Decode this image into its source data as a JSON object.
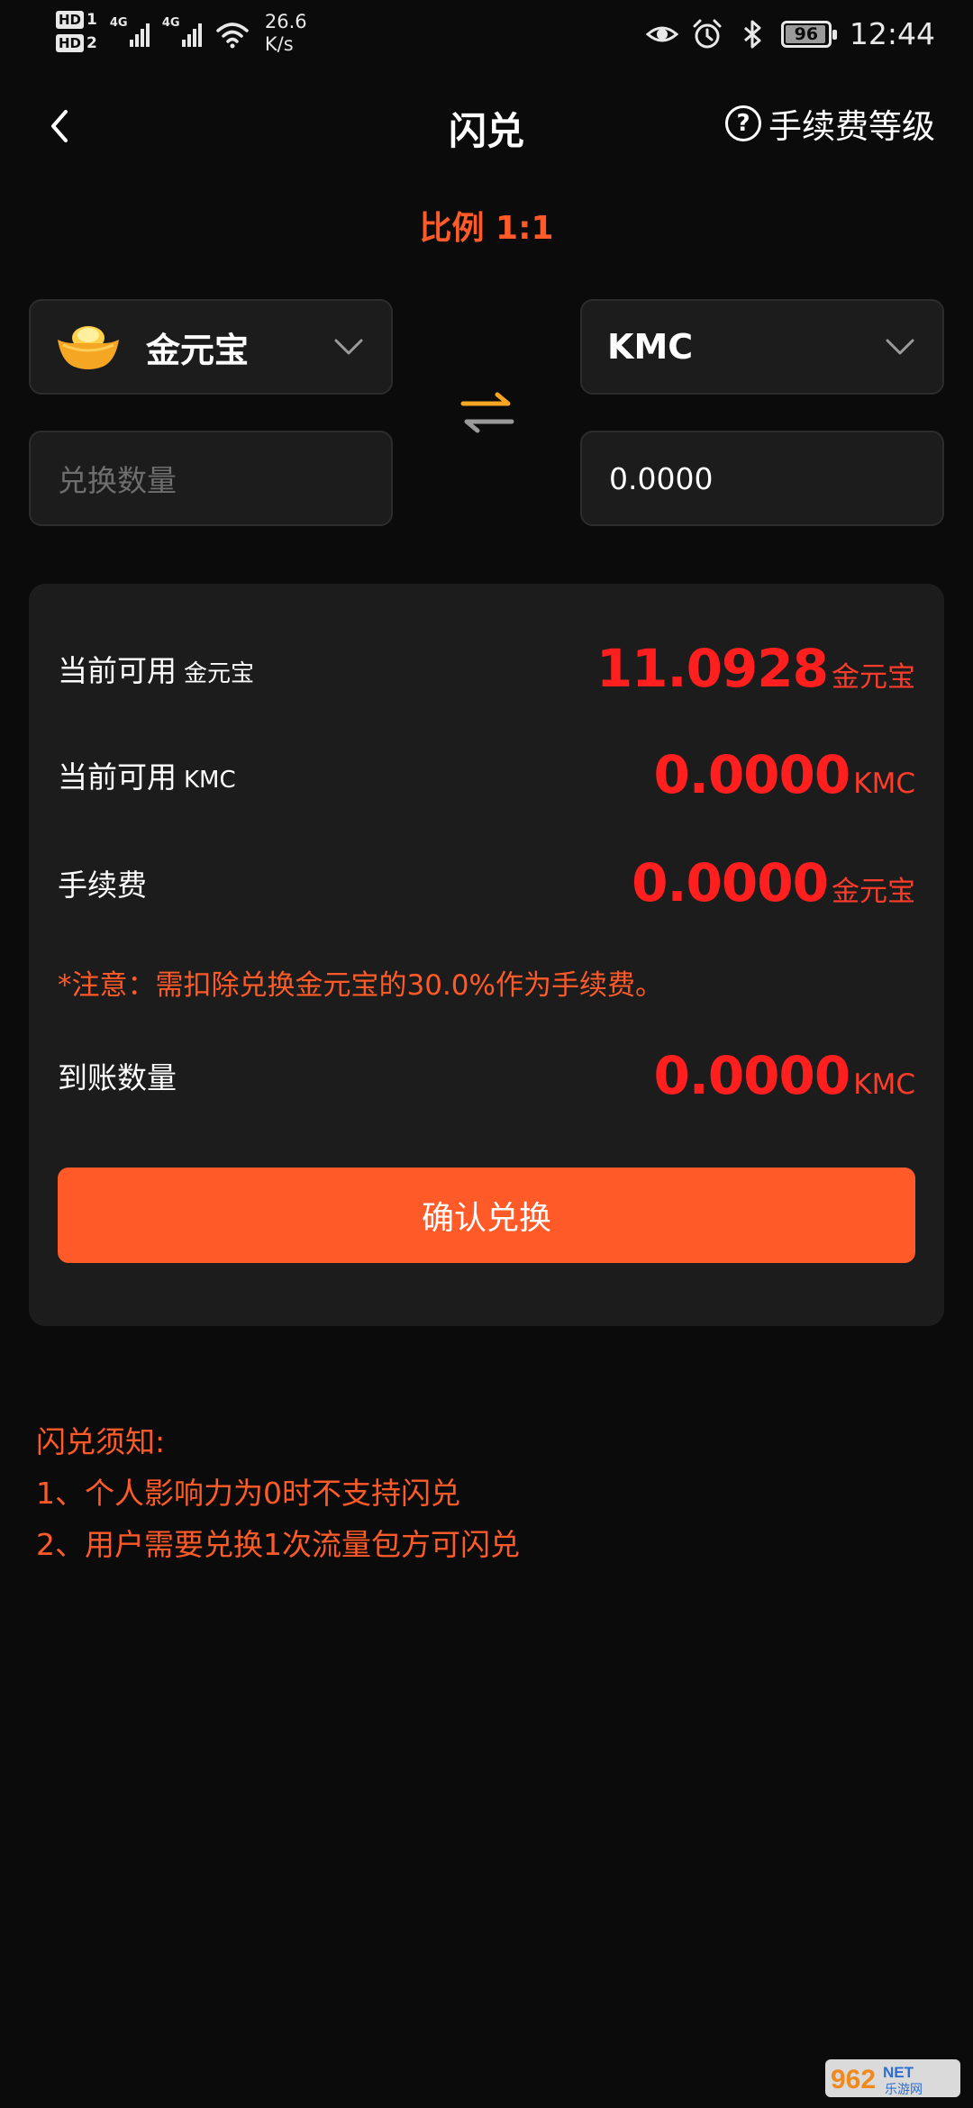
{
  "status_bar": {
    "hd1": "HD",
    "hd1_num": "1",
    "hd2": "HD",
    "hd2_num": "2",
    "net1": "4G",
    "net2": "4G",
    "speed_value": "26.6",
    "speed_unit": "K/s",
    "battery_level": "96",
    "battery_fraction": 0.96,
    "time": "12:44",
    "icons": [
      "eye-icon",
      "alarm-icon",
      "bluetooth-icon"
    ]
  },
  "header": {
    "title": "闪兑",
    "fee_level": "手续费等级"
  },
  "ratio": "比例 1:1",
  "exchange": {
    "from_currency": "金元宝",
    "to_currency": "KMC",
    "amount_placeholder": "兑换数量",
    "to_amount": "0.0000"
  },
  "summary": {
    "available_label": "当前可用",
    "available_from_unit": "金元宝",
    "available_from_value": "11.0928",
    "available_to_unit": "KMC",
    "available_to_value": "0.0000",
    "fee_label": "手续费",
    "fee_value": "0.0000",
    "fee_unit": "金元宝",
    "notice": "*注意：需扣除兑换金元宝的30.0%作为手续费。",
    "received_label": "到账数量",
    "received_value": "0.0000",
    "received_unit": "KMC",
    "confirm_label": "确认兑换"
  },
  "notes": {
    "title": "闪兑须知:",
    "items": [
      "1、个人影响力为0时不支持闪兑",
      "2、用户需要兑换1次流量包方可闪兑"
    ]
  },
  "watermark": {
    "text": "962",
    "suffix": "NET",
    "sub": "乐游网"
  },
  "colors": {
    "background": "#0b0b0b",
    "card": "#1c1c1c",
    "accent": "#ff5a28",
    "value_red": "#ff1f1f",
    "coin_gold": "#f5a623"
  }
}
